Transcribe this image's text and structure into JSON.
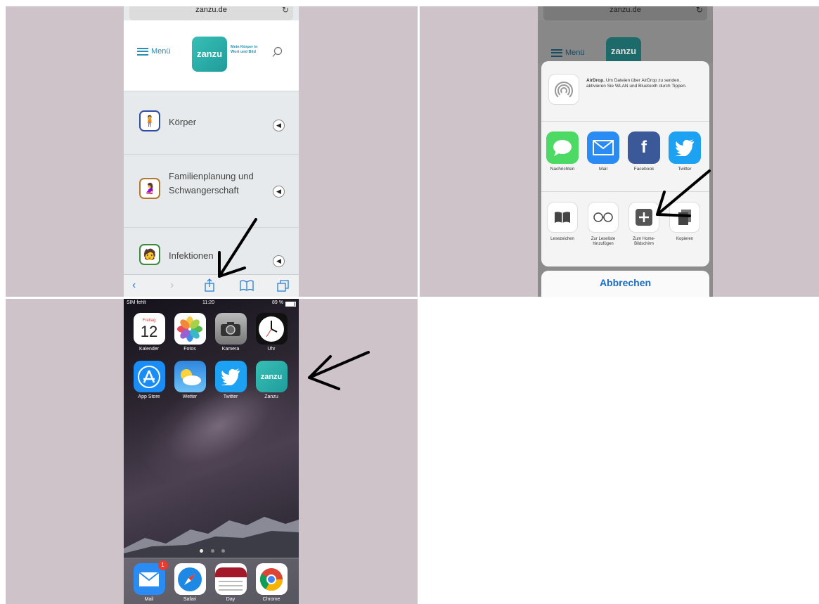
{
  "screen1": {
    "url": "zanzu.de",
    "menu_label": "Menü",
    "logo_text": "zanzu",
    "tagline": "Mein Körper in Wort und Bild",
    "categories": [
      {
        "label": "Körper",
        "color": "#2f4f9e"
      },
      {
        "label": "Familienplanung und Schwangerschaft",
        "color": "#b4772e"
      },
      {
        "label": "Infektionen",
        "color": "#3c8a3c"
      }
    ]
  },
  "screen2": {
    "url": "zanzu.de",
    "menu_label": "Menü",
    "logo_text": "zanzu",
    "airdrop_title": "AirDrop.",
    "airdrop_text": "Um Dateien über AirDrop zu senden, aktivieren Sie WLAN und Bluetooth durch Tippen.",
    "share_apps": [
      {
        "label": "Nachrichten",
        "color": "#4cd964"
      },
      {
        "label": "Mail",
        "color": "#2a8bf2"
      },
      {
        "label": "Facebook",
        "color": "#3b5998"
      },
      {
        "label": "Twitter",
        "color": "#1da1f2"
      }
    ],
    "actions": [
      {
        "label": "Lesezeichen"
      },
      {
        "label": "Zur Leseliste hinzufügen"
      },
      {
        "label": "Zum Home-Bildschirm"
      },
      {
        "label": "Kopieren"
      }
    ],
    "cancel_label": "Abbrechen"
  },
  "screen3": {
    "status": {
      "carrier": "SIM fehlt",
      "time": "11:20",
      "battery": "89 %"
    },
    "calendar": {
      "weekday": "Freitag",
      "day": "12"
    },
    "apps_row1": [
      {
        "label": "Kalender"
      },
      {
        "label": "Fotos"
      },
      {
        "label": "Kamera"
      },
      {
        "label": "Uhr"
      }
    ],
    "apps_row2": [
      {
        "label": "App Store",
        "color": "#1a8df5"
      },
      {
        "label": "Wetter",
        "color": "#4aa7ec"
      },
      {
        "label": "Twitter",
        "color": "#1da1f2"
      },
      {
        "label": "Zanzu",
        "color": "#2aa9a5",
        "glyph": "zanzu"
      }
    ],
    "dock": [
      {
        "label": "Mail",
        "badge": "1"
      },
      {
        "label": "Safari"
      },
      {
        "label": "Day"
      },
      {
        "label": "Chrome"
      }
    ]
  }
}
